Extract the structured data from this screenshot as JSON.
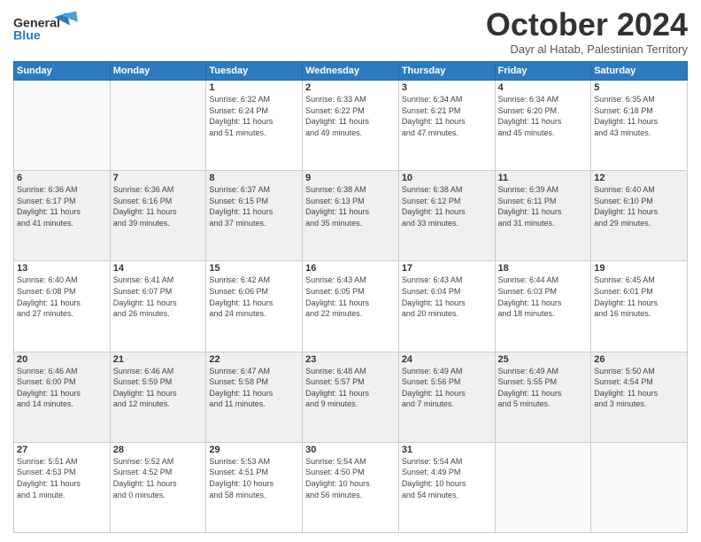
{
  "header": {
    "logo_line1": "General",
    "logo_line2": "Blue",
    "month": "October 2024",
    "location": "Dayr al Hatab, Palestinian Territory"
  },
  "days_of_week": [
    "Sunday",
    "Monday",
    "Tuesday",
    "Wednesday",
    "Thursday",
    "Friday",
    "Saturday"
  ],
  "weeks": [
    [
      {
        "day": "",
        "info": ""
      },
      {
        "day": "",
        "info": ""
      },
      {
        "day": "1",
        "info": "Sunrise: 6:32 AM\nSunset: 6:24 PM\nDaylight: 11 hours\nand 51 minutes."
      },
      {
        "day": "2",
        "info": "Sunrise: 6:33 AM\nSunset: 6:22 PM\nDaylight: 11 hours\nand 49 minutes."
      },
      {
        "day": "3",
        "info": "Sunrise: 6:34 AM\nSunset: 6:21 PM\nDaylight: 11 hours\nand 47 minutes."
      },
      {
        "day": "4",
        "info": "Sunrise: 6:34 AM\nSunset: 6:20 PM\nDaylight: 11 hours\nand 45 minutes."
      },
      {
        "day": "5",
        "info": "Sunrise: 6:35 AM\nSunset: 6:18 PM\nDaylight: 11 hours\nand 43 minutes."
      }
    ],
    [
      {
        "day": "6",
        "info": "Sunrise: 6:36 AM\nSunset: 6:17 PM\nDaylight: 11 hours\nand 41 minutes."
      },
      {
        "day": "7",
        "info": "Sunrise: 6:36 AM\nSunset: 6:16 PM\nDaylight: 11 hours\nand 39 minutes."
      },
      {
        "day": "8",
        "info": "Sunrise: 6:37 AM\nSunset: 6:15 PM\nDaylight: 11 hours\nand 37 minutes."
      },
      {
        "day": "9",
        "info": "Sunrise: 6:38 AM\nSunset: 6:13 PM\nDaylight: 11 hours\nand 35 minutes."
      },
      {
        "day": "10",
        "info": "Sunrise: 6:38 AM\nSunset: 6:12 PM\nDaylight: 11 hours\nand 33 minutes."
      },
      {
        "day": "11",
        "info": "Sunrise: 6:39 AM\nSunset: 6:11 PM\nDaylight: 11 hours\nand 31 minutes."
      },
      {
        "day": "12",
        "info": "Sunrise: 6:40 AM\nSunset: 6:10 PM\nDaylight: 11 hours\nand 29 minutes."
      }
    ],
    [
      {
        "day": "13",
        "info": "Sunrise: 6:40 AM\nSunset: 6:08 PM\nDaylight: 11 hours\nand 27 minutes."
      },
      {
        "day": "14",
        "info": "Sunrise: 6:41 AM\nSunset: 6:07 PM\nDaylight: 11 hours\nand 26 minutes."
      },
      {
        "day": "15",
        "info": "Sunrise: 6:42 AM\nSunset: 6:06 PM\nDaylight: 11 hours\nand 24 minutes."
      },
      {
        "day": "16",
        "info": "Sunrise: 6:43 AM\nSunset: 6:05 PM\nDaylight: 11 hours\nand 22 minutes."
      },
      {
        "day": "17",
        "info": "Sunrise: 6:43 AM\nSunset: 6:04 PM\nDaylight: 11 hours\nand 20 minutes."
      },
      {
        "day": "18",
        "info": "Sunrise: 6:44 AM\nSunset: 6:03 PM\nDaylight: 11 hours\nand 18 minutes."
      },
      {
        "day": "19",
        "info": "Sunrise: 6:45 AM\nSunset: 6:01 PM\nDaylight: 11 hours\nand 16 minutes."
      }
    ],
    [
      {
        "day": "20",
        "info": "Sunrise: 6:46 AM\nSunset: 6:00 PM\nDaylight: 11 hours\nand 14 minutes."
      },
      {
        "day": "21",
        "info": "Sunrise: 6:46 AM\nSunset: 5:59 PM\nDaylight: 11 hours\nand 12 minutes."
      },
      {
        "day": "22",
        "info": "Sunrise: 6:47 AM\nSunset: 5:58 PM\nDaylight: 11 hours\nand 11 minutes."
      },
      {
        "day": "23",
        "info": "Sunrise: 6:48 AM\nSunset: 5:57 PM\nDaylight: 11 hours\nand 9 minutes."
      },
      {
        "day": "24",
        "info": "Sunrise: 6:49 AM\nSunset: 5:56 PM\nDaylight: 11 hours\nand 7 minutes."
      },
      {
        "day": "25",
        "info": "Sunrise: 6:49 AM\nSunset: 5:55 PM\nDaylight: 11 hours\nand 5 minutes."
      },
      {
        "day": "26",
        "info": "Sunrise: 5:50 AM\nSunset: 4:54 PM\nDaylight: 11 hours\nand 3 minutes."
      }
    ],
    [
      {
        "day": "27",
        "info": "Sunrise: 5:51 AM\nSunset: 4:53 PM\nDaylight: 11 hours\nand 1 minute."
      },
      {
        "day": "28",
        "info": "Sunrise: 5:52 AM\nSunset: 4:52 PM\nDaylight: 11 hours\nand 0 minutes."
      },
      {
        "day": "29",
        "info": "Sunrise: 5:53 AM\nSunset: 4:51 PM\nDaylight: 10 hours\nand 58 minutes."
      },
      {
        "day": "30",
        "info": "Sunrise: 5:54 AM\nSunset: 4:50 PM\nDaylight: 10 hours\nand 56 minutes."
      },
      {
        "day": "31",
        "info": "Sunrise: 5:54 AM\nSunset: 4:49 PM\nDaylight: 10 hours\nand 54 minutes."
      },
      {
        "day": "",
        "info": ""
      },
      {
        "day": "",
        "info": ""
      }
    ]
  ]
}
